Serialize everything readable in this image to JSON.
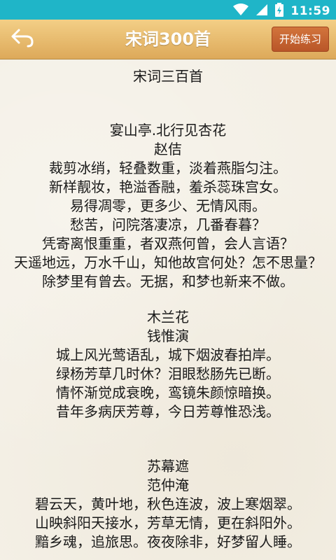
{
  "status_bar": {
    "time": "11:59"
  },
  "app_bar": {
    "title": "宋词300首",
    "practice_button": "开始练习"
  },
  "content": {
    "book_title": "宋词三百首",
    "poems": [
      {
        "title": "宴山亭.北行见杏花",
        "author": "赵佶",
        "lines": [
          "裁剪冰绡，轻叠数重，淡着燕脂匀注。",
          "新样靓妆，艳溢香融，羞杀蕊珠宫女。",
          "易得凋零，更多少、无情风雨。",
          "愁苦，问院落凄凉，几番春暮？",
          "凭寄离恨重重，者双燕何曾，会人言语？",
          "天遥地远，万水千山，知他故宫何处？怎不思量？",
          "除梦里有曾去。无据，和梦也新来不做。"
        ]
      },
      {
        "title": "木兰花",
        "author": "钱惟演",
        "lines": [
          "城上风光莺语乱，城下烟波春拍岸。",
          "绿杨芳草几时休？泪眼愁肠先已断。",
          "情怀渐觉成衰晚，鸾镜朱颜惊暗换。",
          "昔年多病厌芳尊，今日芳尊惟恐浅。"
        ]
      },
      {
        "title": "苏幕遮",
        "author": "范仲淹",
        "lines": [
          "碧云天，黄叶地，秋色连波，波上寒烟翠。",
          "山映斜阳天接水，芳草无情，更在斜阳外。",
          "黯乡魂，追旅思。夜夜除非，好梦留人睡。"
        ]
      }
    ]
  }
}
